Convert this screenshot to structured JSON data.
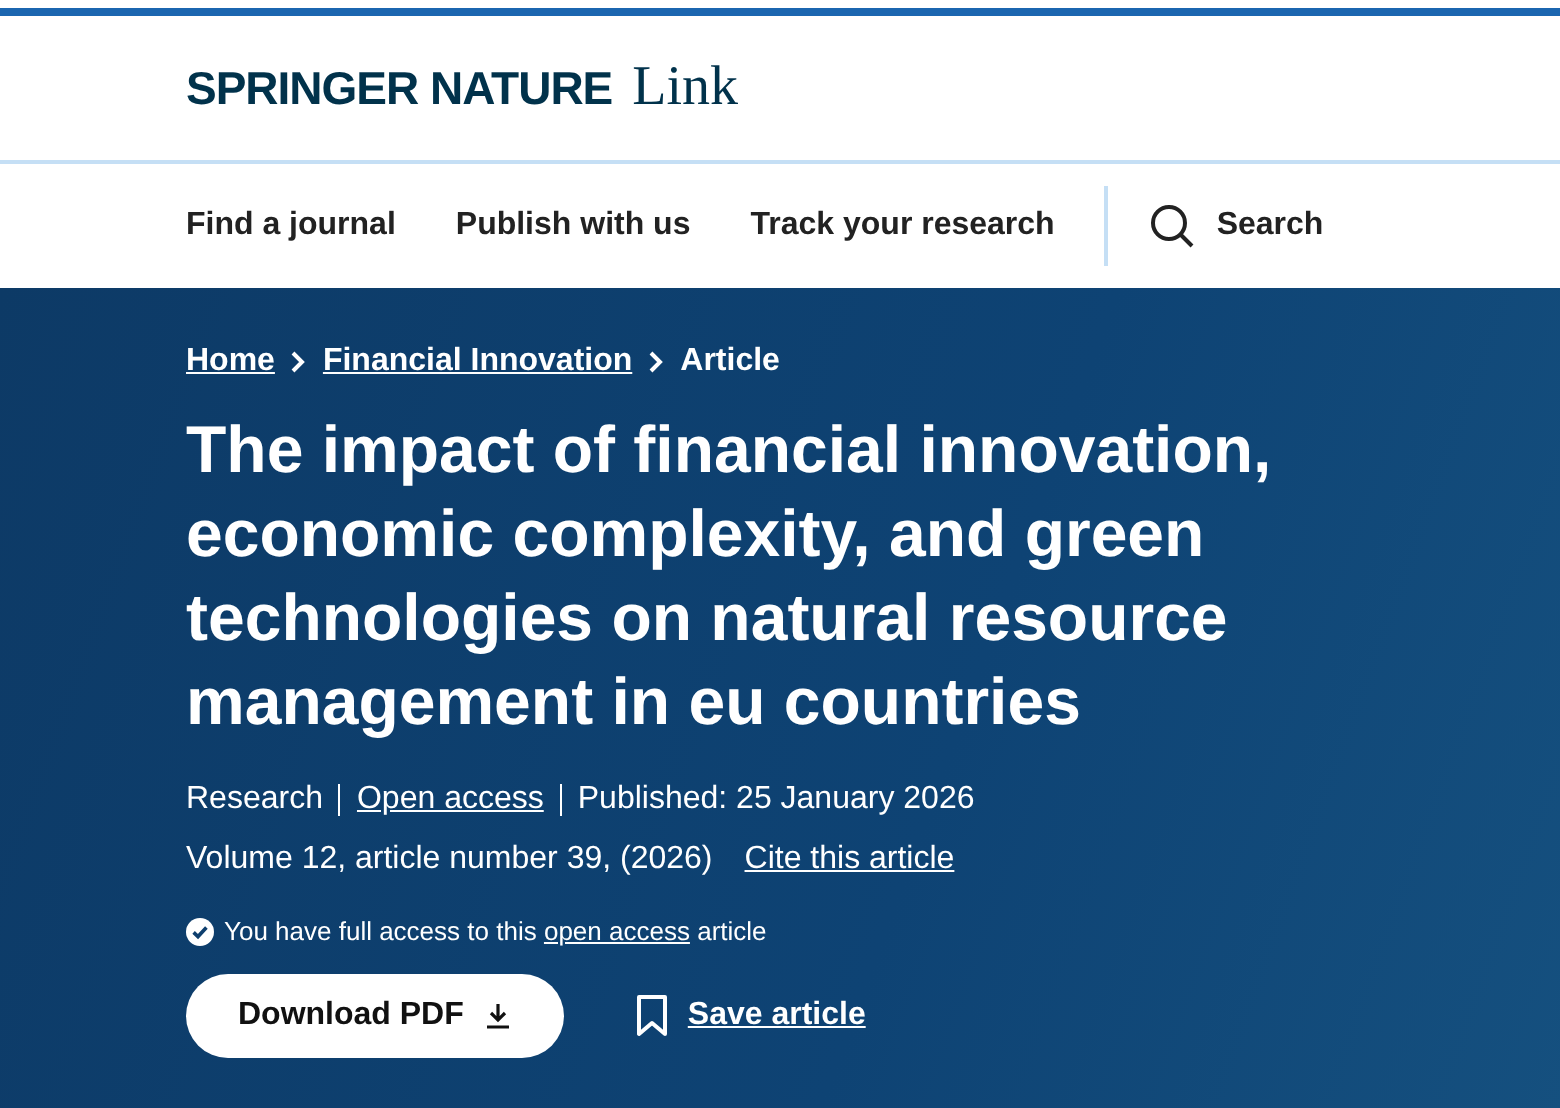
{
  "logo": {
    "brand": "SPRINGER NATURE",
    "product": "Link"
  },
  "nav": {
    "items": [
      "Find a journal",
      "Publish with us",
      "Track your research"
    ],
    "search": "Search"
  },
  "breadcrumbs": [
    {
      "label": "Home",
      "link": true
    },
    {
      "label": "Financial Innovation",
      "link": true
    },
    {
      "label": "Article",
      "link": false
    }
  ],
  "title": "The impact of financial innovation, economic complexity, and green technologies on natural resource management in eu countries",
  "meta": [
    {
      "label": "Research",
      "link": false
    },
    {
      "label": "Open access",
      "link": true
    },
    {
      "label": "Published: 25 January 2026",
      "link": false
    }
  ],
  "citation": {
    "text": "Volume 12, article number 39, (2026)",
    "link": "Cite this article"
  },
  "access": {
    "before": "You have full access to this",
    "link": "open access",
    "after": "article"
  },
  "actions": {
    "download": "Download PDF",
    "save": "Save article"
  }
}
